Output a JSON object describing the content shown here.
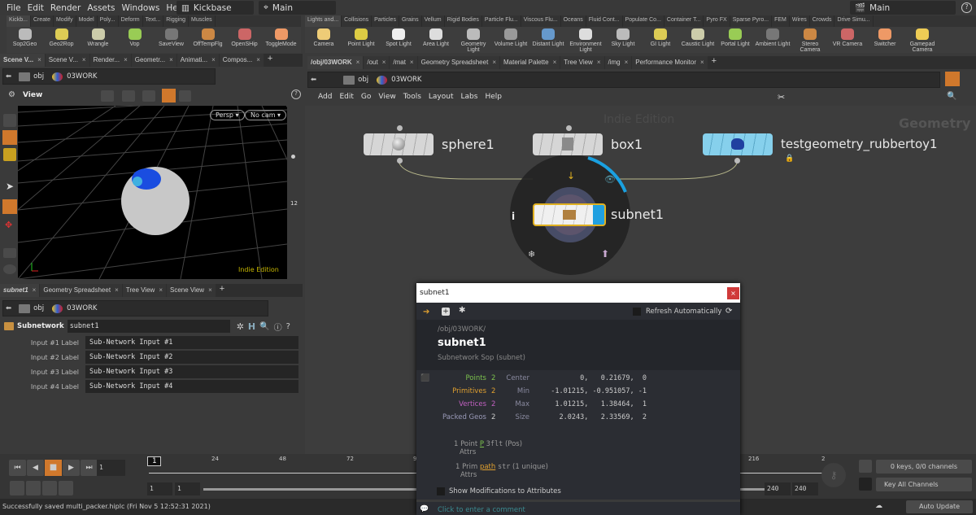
{
  "menu": [
    "File",
    "Edit",
    "Render",
    "Assets",
    "Windows",
    "Help"
  ],
  "desktop": "Kickbase",
  "context": "Main",
  "context_right": "Main",
  "shelf_left": {
    "tabs": [
      "Kickb...",
      "Create",
      "Modify",
      "Model",
      "Poly...",
      "Deform",
      "Text...",
      "Rigging",
      "Muscles"
    ],
    "tools": [
      "Sop2Geo",
      "Geo2Rop",
      "Wrangle",
      "Vop",
      "SaveView",
      "OffTempFlg",
      "OpenSHip",
      "ToggleMode"
    ]
  },
  "shelf_right": {
    "tabs": [
      "Lights and...",
      "Collisions",
      "Particles",
      "Grains",
      "Vellum",
      "Rigid Bodies",
      "Particle Flu...",
      "Viscous Flu...",
      "Oceans",
      "Fluid Cont...",
      "Populate Co...",
      "Container T...",
      "Pyro FX",
      "Sparse Pyro...",
      "FEM",
      "Wires",
      "Crowds",
      "Drive Simu..."
    ],
    "tools": [
      "Camera",
      "Point Light",
      "Spot Light",
      "Area Light",
      "Geometry Light",
      "Volume Light",
      "Distant Light",
      "Environment Light",
      "Sky Light",
      "GI Light",
      "Caustic Light",
      "Portal Light",
      "Ambient Light",
      "Stereo Camera",
      "VR Camera",
      "Switcher",
      "Gamepad Camera"
    ]
  },
  "left_tabs": [
    "Scene V...",
    "Scene V...",
    "Render...",
    "Geometr...",
    "Animati...",
    "Compos..."
  ],
  "path": {
    "root": "obj",
    "node": "03WORK"
  },
  "viewer": {
    "title": "View",
    "persp": "Persp",
    "cam": "No cam",
    "watermark": "Indie Edition"
  },
  "bottom_tabs": [
    "subnet1",
    "Geometry Spreadsheet",
    "Tree View",
    "Scene View"
  ],
  "params": {
    "type": "Subnetwork",
    "name": "subnet1",
    "rows": [
      {
        "label": "Input #1 Label",
        "value": "Sub-Network Input #1"
      },
      {
        "label": "Input #2 Label",
        "value": "Sub-Network Input #2"
      },
      {
        "label": "Input #3 Label",
        "value": "Sub-Network Input #3"
      },
      {
        "label": "Input #4 Label",
        "value": "Sub-Network Input #4"
      }
    ]
  },
  "net_tabs": [
    "/obj/03WORK",
    "/out",
    "/mat",
    "Geometry Spreadsheet",
    "Material Palette",
    "Tree View",
    "/img",
    "Performance Monitor"
  ],
  "net_menu": [
    "Add",
    "Edit",
    "Go",
    "View",
    "Tools",
    "Layout",
    "Labs",
    "Help"
  ],
  "network": {
    "watermark": "Indie Edition",
    "context_label": "Geometry",
    "nodes": [
      "sphere1",
      "box1",
      "testgeometry_rubbertoy1",
      "subnet1"
    ]
  },
  "popup": {
    "title": "subnet1",
    "refresh": "Refresh Automatically",
    "path": "/obj/03WORK/",
    "name": "subnet1",
    "type": "Subnetwork Sop (subnet)",
    "stats": [
      {
        "label": "Points",
        "value": "2",
        "color": "#7cc24e"
      },
      {
        "label": "Primitives",
        "value": "2",
        "color": "#e0a030"
      },
      {
        "label": "Vertices",
        "value": "2",
        "color": "#c060c0"
      },
      {
        "label": "Packed Geos",
        "value": "2",
        "color": "#9a9ab8"
      }
    ],
    "bounds": [
      {
        "label": "Center",
        "value": "0,   0.21679,  0"
      },
      {
        "label": "Min",
        "value": "-1.01215, -0.951057, -1"
      },
      {
        "label": "Max",
        "value": "1.01215,   1.38464,  1"
      },
      {
        "label": "Size",
        "value": "2.0243,   2.33569,  2"
      }
    ],
    "point_attrs": {
      "count": "1 Point",
      "attrs": "Attrs",
      "name": "P",
      "type": "3flt",
      "extra": "(Pos)"
    },
    "prim_attrs": {
      "count": "1 Prim",
      "attrs": "Attrs",
      "name": "path",
      "type": "str",
      "extra": "(1 unique)"
    },
    "show_mods": "Show Modifications to Attributes",
    "comment": "Click to enter a comment"
  },
  "timeline": {
    "frame": "1",
    "marker": "1",
    "ticks": [
      "24",
      "48",
      "72",
      "9",
      "216",
      "2"
    ],
    "start": "1",
    "start2": "1",
    "end": "240",
    "end2": "240"
  },
  "keys": {
    "channels": "0 keys, 0/0 channels",
    "key_all": "Key All Channels",
    "update": "Auto Update"
  },
  "status": "Successfully saved multi_packer.hiplc (Fri Nov  5 12:52:31 2021)"
}
